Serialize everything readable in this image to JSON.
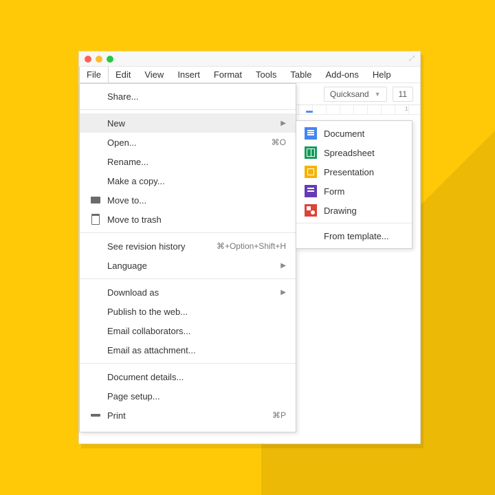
{
  "menubar": [
    "File",
    "Edit",
    "View",
    "Insert",
    "Format",
    "Tools",
    "Table",
    "Add-ons",
    "Help"
  ],
  "toolbar": {
    "font": "Quicksand",
    "fontsize": "11"
  },
  "ruler": {
    "mark": "1"
  },
  "file_menu": {
    "share": "Share...",
    "new": "New",
    "open": {
      "label": "Open...",
      "shortcut": "⌘O"
    },
    "rename": "Rename...",
    "make_copy": "Make a copy...",
    "move_to": "Move to...",
    "move_trash": "Move to trash",
    "revision": {
      "label": "See revision history",
      "shortcut": "⌘+Option+Shift+H"
    },
    "language": "Language",
    "download_as": "Download as",
    "publish": "Publish to the web...",
    "email_collab": "Email collaborators...",
    "email_attach": "Email as attachment...",
    "doc_details": "Document details...",
    "page_setup": "Page setup...",
    "print": {
      "label": "Print",
      "shortcut": "⌘P"
    }
  },
  "new_submenu": {
    "document": "Document",
    "spreadsheet": "Spreadsheet",
    "presentation": "Presentation",
    "form": "Form",
    "drawing": "Drawing",
    "template": "From template..."
  }
}
